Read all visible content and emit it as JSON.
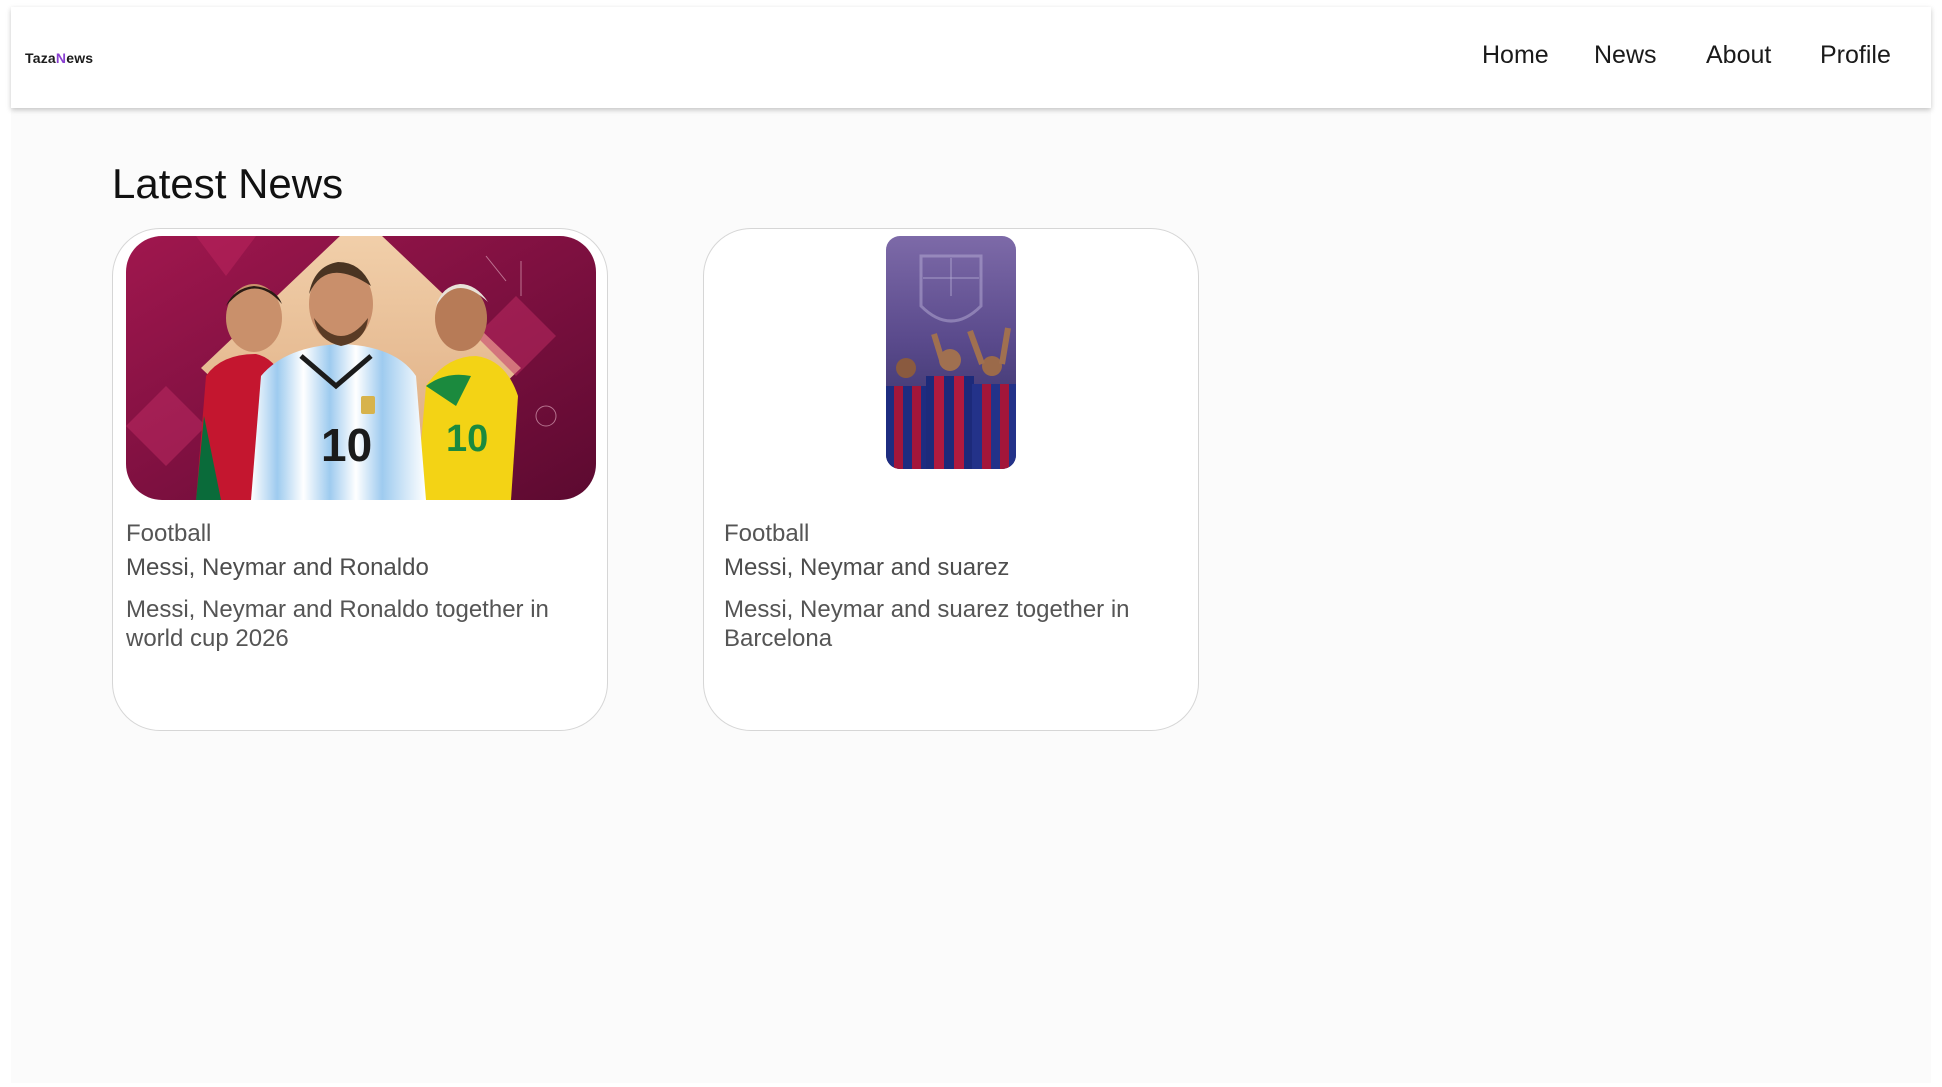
{
  "header": {
    "logo": {
      "first": "Taza",
      "accent": "N",
      "rest": "ews"
    },
    "nav": [
      {
        "label": "Home"
      },
      {
        "label": "News"
      },
      {
        "label": "About"
      },
      {
        "label": "Profile"
      }
    ]
  },
  "main": {
    "title": "Latest News",
    "cards": [
      {
        "category": "Football",
        "headline": "Messi, Neymar and Ronaldo",
        "summary": "Messi, Neymar and Ronaldo together in world cup 2026",
        "image": "football-players-photo"
      },
      {
        "category": "Football",
        "headline": "Messi, Neymar and suarez",
        "summary": "Messi, Neymar and suarez together in Barcelona",
        "image": "barcelona-players-photo"
      }
    ]
  },
  "colors": {
    "accent": "#8a3fd1",
    "page_bg": "#fbfbfb",
    "card_border": "#d6d6d6"
  }
}
